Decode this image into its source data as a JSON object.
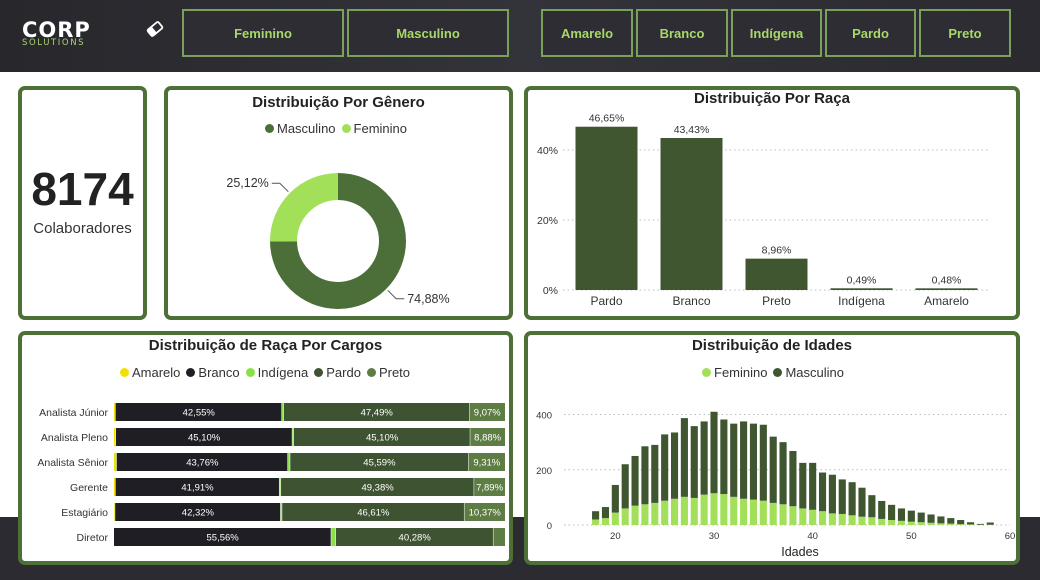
{
  "header": {
    "logo_main": "CORP",
    "logo_sub": "SOLUTIONS",
    "gender_slicers": [
      "Feminino",
      "Masculino"
    ],
    "race_slicers": [
      "Amarelo",
      "Branco",
      "Indígena",
      "Pardo",
      "Preto"
    ]
  },
  "kpi": {
    "value": "8174",
    "label": "Colaboradores"
  },
  "colors": {
    "masculino": "#4c6e38",
    "feminino": "#a3e05a",
    "bar": "#3f5630",
    "amarelo": "#f2e100",
    "branco": "#1e1e24",
    "indigena": "#8be04a",
    "pardo": "#3e5331",
    "preto": "#5e7d44",
    "card_border": "#4c7035"
  },
  "chart_data": [
    {
      "type": "pie",
      "title": "Distribuição Por Gênero",
      "legend": [
        "Masculino",
        "Feminino"
      ],
      "slices": [
        {
          "name": "Masculino",
          "value": 74.88,
          "label": "74,88%"
        },
        {
          "name": "Feminino",
          "value": 25.12,
          "label": "25,12%"
        }
      ]
    },
    {
      "type": "bar",
      "title": "Distribuição Por Raça",
      "categories": [
        "Pardo",
        "Branco",
        "Preto",
        "Indígena",
        "Amarelo"
      ],
      "values": [
        46.65,
        43.43,
        8.96,
        0.49,
        0.48
      ],
      "data_labels": [
        "46,65%",
        "43,43%",
        "8,96%",
        "0,49%",
        "0,48%"
      ],
      "yticks": [
        "0%",
        "20%",
        "40%"
      ],
      "ylim": [
        0,
        50
      ]
    },
    {
      "type": "bar",
      "orientation": "horizontal-stacked-100",
      "title": "Distribuição de Raça Por Cargos",
      "legend": [
        "Amarelo",
        "Branco",
        "Indígena",
        "Pardo",
        "Preto"
      ],
      "categories": [
        "Analista Júnior",
        "Analista Pleno",
        "Analista Sênior",
        "Gerente",
        "Estagiário",
        "Diretor"
      ],
      "series": [
        {
          "name": "Amarelo",
          "values": [
            0.4,
            0.5,
            0.7,
            0.4,
            0.3,
            0.0
          ]
        },
        {
          "name": "Branco",
          "values": [
            42.55,
            45.1,
            43.76,
            41.91,
            42.32,
            55.56
          ]
        },
        {
          "name": "Indígena",
          "values": [
            0.5,
            0.4,
            0.6,
            0.4,
            0.4,
            1.2
          ]
        },
        {
          "name": "Pardo",
          "values": [
            47.49,
            45.1,
            45.59,
            49.38,
            46.61,
            40.28
          ]
        },
        {
          "name": "Preto",
          "values": [
            9.07,
            8.88,
            9.31,
            7.89,
            10.37,
            2.96
          ]
        }
      ],
      "data_labels": [
        [
          "42,55%",
          "47,49%",
          "9,07%"
        ],
        [
          "45,10%",
          "45,10%",
          "8,88%"
        ],
        [
          "43,76%",
          "45,59%",
          "9,31%"
        ],
        [
          "41,91%",
          "49,38%",
          "7,89%"
        ],
        [
          "42,32%",
          "46,61%",
          "10,37%"
        ],
        [
          "55,56%",
          "40,28%",
          ""
        ]
      ]
    },
    {
      "type": "bar",
      "stacked": true,
      "title": "Distribuição de Idades",
      "legend": [
        "Feminino",
        "Masculino"
      ],
      "xlabel": "Idades",
      "xticks": [
        "20",
        "30",
        "40",
        "50",
        "60"
      ],
      "yticks": [
        "0",
        "200",
        "400"
      ],
      "xlim": [
        15,
        60
      ],
      "ylim": [
        0,
        420
      ],
      "x": [
        18,
        19,
        20,
        21,
        22,
        23,
        24,
        25,
        26,
        27,
        28,
        29,
        30,
        31,
        32,
        33,
        34,
        35,
        36,
        37,
        38,
        39,
        40,
        41,
        42,
        43,
        44,
        45,
        46,
        47,
        48,
        49,
        50,
        51,
        52,
        53,
        54,
        55,
        56,
        57,
        58
      ],
      "series": [
        {
          "name": "Feminino",
          "values": [
            20,
            25,
            45,
            60,
            70,
            75,
            80,
            88,
            95,
            102,
            98,
            110,
            115,
            112,
            102,
            95,
            92,
            88,
            80,
            75,
            68,
            60,
            55,
            50,
            42,
            40,
            35,
            30,
            28,
            22,
            18,
            15,
            12,
            10,
            8,
            6,
            5,
            3,
            2,
            1,
            1
          ]
        },
        {
          "name": "Masculino",
          "values": [
            30,
            40,
            100,
            160,
            180,
            210,
            210,
            240,
            240,
            285,
            260,
            265,
            295,
            270,
            265,
            280,
            275,
            275,
            240,
            225,
            200,
            165,
            170,
            140,
            140,
            125,
            120,
            105,
            80,
            65,
            55,
            45,
            40,
            35,
            30,
            25,
            20,
            15,
            8,
            3,
            8
          ]
        }
      ]
    }
  ]
}
